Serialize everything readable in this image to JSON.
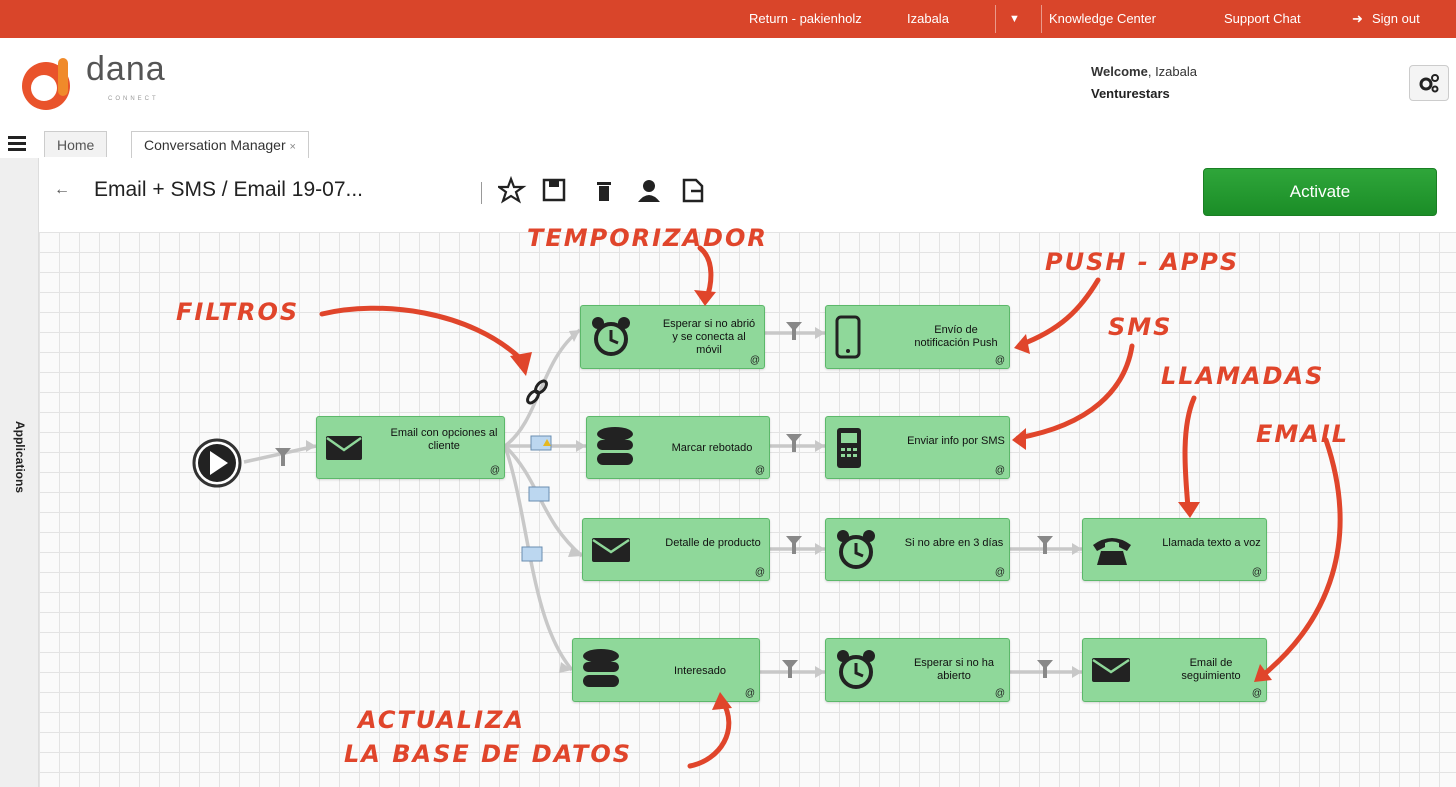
{
  "topbar": {
    "return_link": "Return - pakienholz",
    "user": "Izabala",
    "knowledge_center": "Knowledge Center",
    "support_chat": "Support Chat",
    "sign_out": "Sign out",
    "color": "#d9452a"
  },
  "header": {
    "logo_text": "dana",
    "logo_sub": "CONNECT",
    "welcome_label": "Welcome",
    "welcome_user": ", Izabala",
    "company": "Venturestars"
  },
  "tabs": [
    {
      "label": "Home"
    },
    {
      "label": "Conversation Manager",
      "close": "×"
    }
  ],
  "sidebar": {
    "label": "Applications"
  },
  "toolbar": {
    "back_icon": "←",
    "title": "Email + SMS / Email 19-07...",
    "activate_label": "Activate"
  },
  "nodes": {
    "email_options": "Email con opciones al cliente",
    "wait_mobile": "Esperar si no abrió y se conecta al móvil",
    "push": "Envío de notificación Push",
    "mark_bounced": "Marcar rebotado",
    "sms": "Enviar info por SMS",
    "product_detail": "Detalle de producto",
    "wait_3_days": "Si no abre en 3 días",
    "voice_call": "Llamada texto a voz",
    "interested": "Interesado",
    "wait_not_opened": "Esperar si no ha abierto",
    "followup_email": "Email de seguimiento"
  },
  "annotations": {
    "temporizador": "TEMPORIZADOR",
    "push_apps": "PUSH - APPS",
    "filtros": "FILTROS",
    "sms": "SMS",
    "llamadas": "LLAMADAS",
    "email": "EMAIL",
    "actualiza_1": "ACTUALIZA",
    "actualiza_2": "LA BASE DE DATOS",
    "color": "#e0452b"
  },
  "colors": {
    "node_fill": "#8fd89a",
    "node_border": "#5cb86a",
    "activate": "#1f9a2d"
  }
}
